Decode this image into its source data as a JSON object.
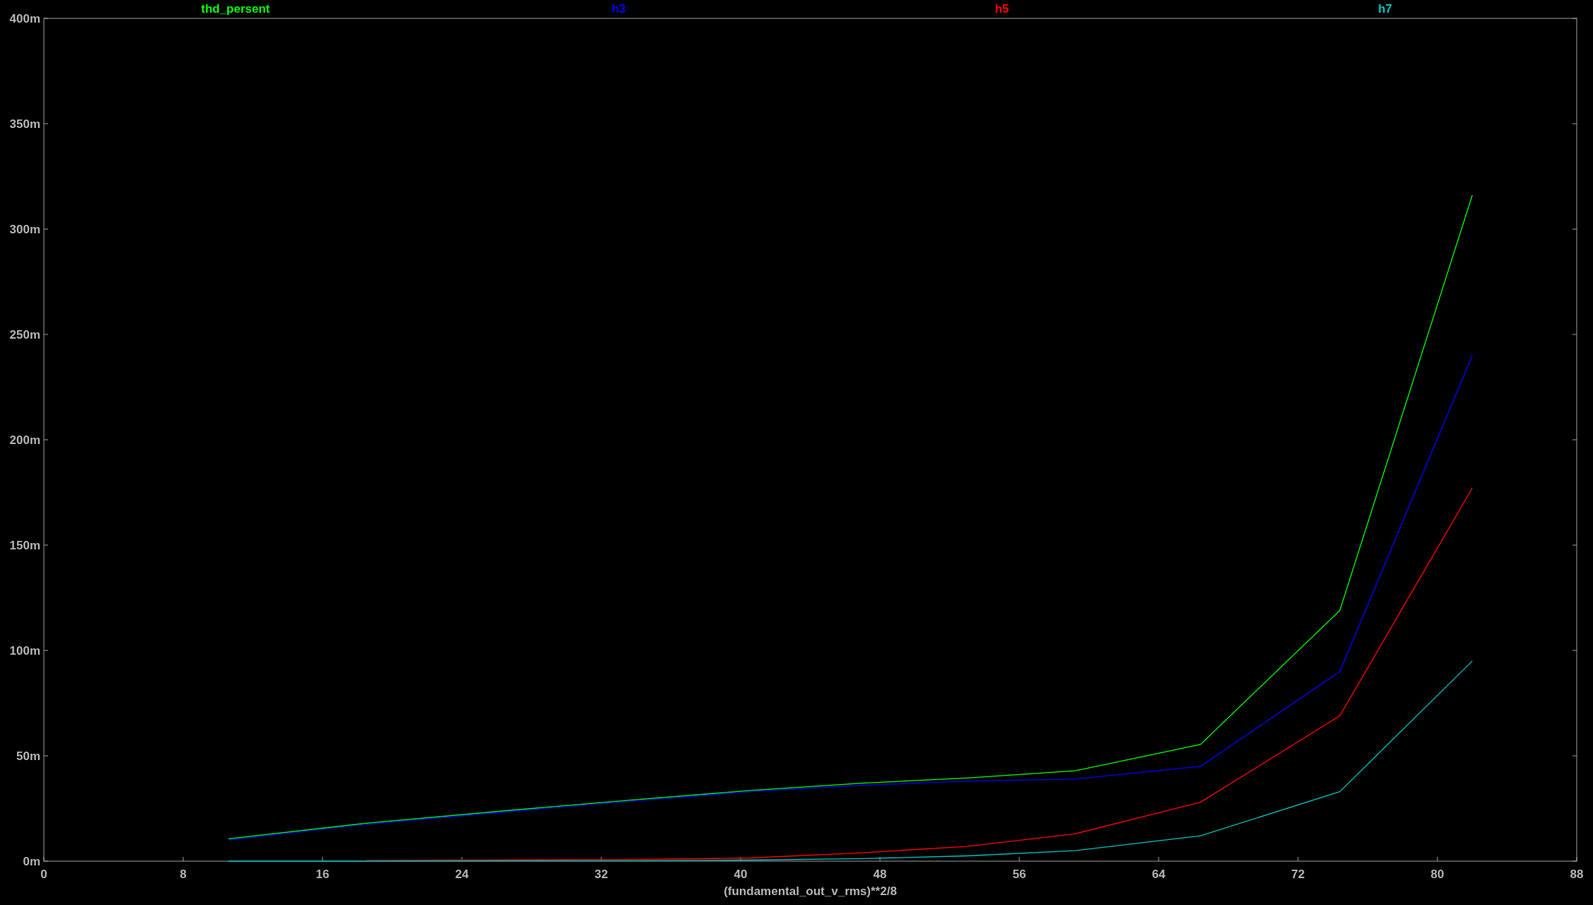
{
  "chart_data": {
    "type": "line",
    "xlabel": "(fundamental_out_v_rms)**2/8",
    "x": [
      10.6,
      18.5,
      26.6,
      33.7,
      40.5,
      47,
      53,
      59.2,
      66.4,
      74.4,
      82
    ],
    "series": [
      {
        "name": "thd_persent",
        "color": "#00ff00",
        "values": [
          10.6,
          18,
          24,
          29,
          33.5,
          37,
          39.5,
          42.9,
          55.4,
          119,
          316
        ]
      },
      {
        "name": "h3",
        "color": "#0000ff",
        "values": [
          10,
          17.5,
          23.5,
          28.5,
          33,
          36,
          38,
          39,
          45,
          90,
          240
        ]
      },
      {
        "name": "h5",
        "color": "#ff0000",
        "values": [
          null,
          0.3,
          0.5,
          0.8,
          1.5,
          4,
          7,
          13,
          28,
          69,
          177
        ]
      },
      {
        "name": "h7",
        "color": "#00c0c0",
        "values": [
          0,
          0,
          0.1,
          0.2,
          0.5,
          1.2,
          2.5,
          5,
          12,
          33,
          95
        ]
      }
    ],
    "xlim": [
      0,
      88
    ],
    "ylim": [
      0,
      400
    ],
    "xticks": [
      0,
      8,
      16,
      24,
      32,
      40,
      48,
      56,
      64,
      72,
      80,
      88
    ],
    "yticks": [
      {
        "value": 0,
        "label": "0m"
      },
      {
        "value": 50,
        "label": "50m"
      },
      {
        "value": 100,
        "label": "100m"
      },
      {
        "value": 150,
        "label": "150m"
      },
      {
        "value": 200,
        "label": "200m"
      },
      {
        "value": 250,
        "label": "250m"
      },
      {
        "value": 300,
        "label": "300m"
      },
      {
        "value": 350,
        "label": "350m"
      },
      {
        "value": 400,
        "label": "400m"
      }
    ]
  }
}
